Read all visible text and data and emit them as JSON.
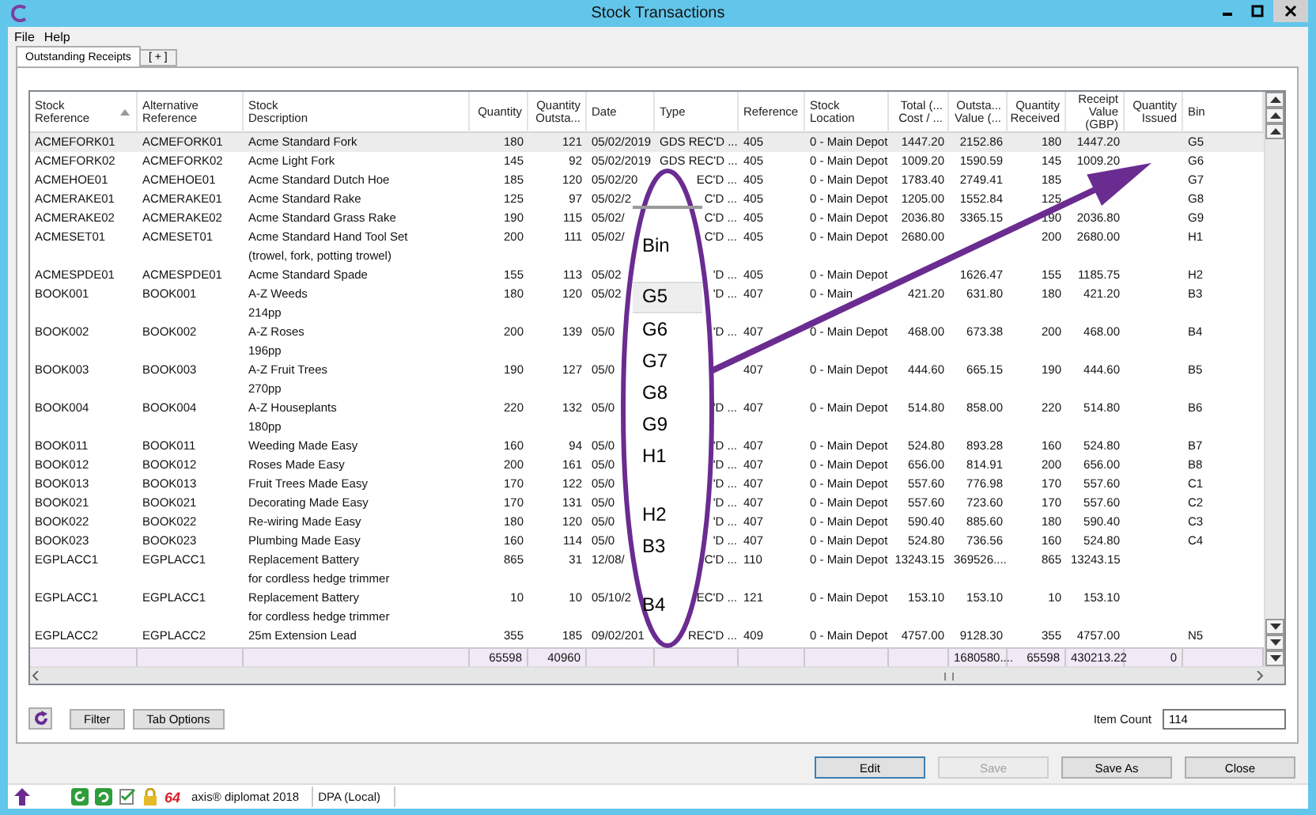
{
  "window": {
    "title": "Stock Transactions"
  },
  "menu": [
    "File",
    "Help"
  ],
  "tabs": [
    {
      "label": "Outstanding Receipts",
      "selected": true
    },
    {
      "label": "[ + ]",
      "selected": false
    }
  ],
  "table": {
    "columns": [
      {
        "label": [
          "Stock",
          "Reference"
        ],
        "sorted": true
      },
      {
        "label": [
          "Alternative",
          "Reference"
        ],
        "sorted": false
      },
      {
        "label": [
          "Stock",
          "Description"
        ],
        "sorted": false
      },
      {
        "label": [
          "Quantity"
        ],
        "sorted": false
      },
      {
        "label": [
          "Quantity",
          "Outsta..."
        ],
        "sorted": false
      },
      {
        "label": [
          "Date"
        ],
        "sorted": false
      },
      {
        "label": [
          "Type"
        ],
        "sorted": false
      },
      {
        "label": [
          "Reference"
        ],
        "sorted": false
      },
      {
        "label": [
          "Stock",
          "Location"
        ],
        "sorted": false
      },
      {
        "label": [
          "Total (...",
          "Cost / ..."
        ],
        "sorted": false
      },
      {
        "label": [
          "Outsta...",
          "Value (..."
        ],
        "sorted": false
      },
      {
        "label": [
          "Quantity",
          "Received"
        ],
        "sorted": false
      },
      {
        "label": [
          "Receipt",
          "Value",
          "(GBP)"
        ],
        "sorted": false
      },
      {
        "label": [
          "Quantity",
          "Issued"
        ],
        "sorted": false
      },
      {
        "label": [
          "Bin"
        ],
        "sorted": false
      }
    ],
    "rows": [
      {
        "selected": true,
        "stock_ref": "ACMEFORK01",
        "alt_ref": "ACMEFORK01",
        "description": [
          "Acme Standard Fork"
        ],
        "quantity": "180",
        "qty_outstanding": "121",
        "date": "05/02/2019",
        "type": "GDS REC'D ...",
        "reference": "405",
        "location": "0 - Main Depot",
        "total_cost": "1447.20",
        "outstanding_value": "2152.86",
        "qty_received": "180",
        "receipt_value": "1447.20",
        "bin": "G5"
      },
      {
        "selected": false,
        "stock_ref": "ACMEFORK02",
        "alt_ref": "ACMEFORK02",
        "description": [
          "Acme Light Fork"
        ],
        "quantity": "145",
        "qty_outstanding": "92",
        "date": "05/02/2019",
        "type": "GDS REC'D ...",
        "reference": "405",
        "location": "0 - Main Depot",
        "total_cost": "1009.20",
        "outstanding_value": "1590.59",
        "qty_received": "145",
        "receipt_value": "1009.20",
        "bin": "G6"
      },
      {
        "selected": false,
        "stock_ref": "ACMEHOE01",
        "alt_ref": "ACMEHOE01",
        "description": [
          "Acme Standard Dutch Hoe"
        ],
        "quantity": "185",
        "qty_outstanding": "120",
        "date": "05/02/20",
        "type": "EC'D ...",
        "reference": "405",
        "location": "0 - Main Depot",
        "total_cost": "1783.40",
        "outstanding_value": "2749.41",
        "qty_received": "185",
        "bin": "G7"
      },
      {
        "selected": false,
        "stock_ref": "ACMERAKE01",
        "alt_ref": "ACMERAKE01",
        "description": [
          "Acme Standard Rake"
        ],
        "quantity": "125",
        "qty_outstanding": "97",
        "date": "05/02/2",
        "type": "C'D ...",
        "reference": "405",
        "location": "0 - Main Depot",
        "total_cost": "1205.00",
        "outstanding_value": "1552.84",
        "qty_received": "125",
        "bin": "G8"
      },
      {
        "selected": false,
        "stock_ref": "ACMERAKE02",
        "alt_ref": "ACMERAKE02",
        "description": [
          "Acme Standard Grass Rake"
        ],
        "quantity": "190",
        "qty_outstanding": "115",
        "date": "05/02/",
        "type": "C'D ...",
        "reference": "405",
        "location": "0 - Main Depot",
        "total_cost": "2036.80",
        "outstanding_value": "3365.15",
        "qty_received": "190",
        "receipt_value": "2036.80",
        "bin": "G9"
      },
      {
        "selected": false,
        "stock_ref": "ACMESET01",
        "alt_ref": "ACMESET01",
        "description": [
          "Acme Standard Hand Tool Set",
          "(trowel, fork, potting trowel)"
        ],
        "quantity": "200",
        "qty_outstanding": "111",
        "date": "05/02/",
        "type": "C'D ...",
        "reference": "405",
        "location": "0 - Main Depot",
        "total_cost": "2680.00",
        "qty_received": "200",
        "receipt_value": "2680.00",
        "bin": "H1"
      },
      {
        "selected": false,
        "stock_ref": "ACMESPDE01",
        "alt_ref": "ACMESPDE01",
        "description": [
          "Acme Standard Spade"
        ],
        "quantity": "155",
        "qty_outstanding": "113",
        "date": "05/02",
        "type": "'D ...",
        "reference": "405",
        "location": "0 - Main Depot",
        "outstanding_value": "1626.47",
        "qty_received": "155",
        "receipt_value": "1185.75",
        "bin": "H2"
      },
      {
        "selected": false,
        "stock_ref": "BOOK001",
        "alt_ref": "BOOK001",
        "description": [
          "A-Z Weeds",
          "214pp"
        ],
        "quantity": "180",
        "qty_outstanding": "120",
        "date": "05/02",
        "type": "'D ...",
        "reference": "407",
        "location": "0 - Main",
        "total_cost": "421.20",
        "outstanding_value": "631.80",
        "qty_received": "180",
        "receipt_value": "421.20",
        "bin": "B3"
      },
      {
        "selected": false,
        "stock_ref": "BOOK002",
        "alt_ref": "BOOK002",
        "description": [
          "A-Z Roses",
          "196pp"
        ],
        "quantity": "200",
        "qty_outstanding": "139",
        "date": "05/0",
        "type": "'D ...",
        "reference": "407",
        "location": "0 - Main Depot",
        "total_cost": "468.00",
        "outstanding_value": "673.38",
        "qty_received": "200",
        "receipt_value": "468.00",
        "bin": "B4"
      },
      {
        "selected": false,
        "stock_ref": "BOOK003",
        "alt_ref": "BOOK003",
        "description": [
          "A-Z Fruit Trees",
          "270pp"
        ],
        "quantity": "190",
        "qty_outstanding": "127",
        "date": "05/0",
        "reference": "407",
        "location": "0 - Main Depot",
        "total_cost": "444.60",
        "outstanding_value": "665.15",
        "qty_received": "190",
        "receipt_value": "444.60",
        "bin": "B5"
      },
      {
        "selected": false,
        "stock_ref": "BOOK004",
        "alt_ref": "BOOK004",
        "description": [
          "A-Z Houseplants",
          "180pp"
        ],
        "quantity": "220",
        "qty_outstanding": "132",
        "date": "05/0",
        "type": "'D ...",
        "reference": "407",
        "location": "0 - Main Depot",
        "total_cost": "514.80",
        "outstanding_value": "858.00",
        "qty_received": "220",
        "receipt_value": "514.80",
        "bin": "B6"
      },
      {
        "selected": false,
        "stock_ref": "BOOK011",
        "alt_ref": "BOOK011",
        "description": [
          "Weeding Made Easy"
        ],
        "quantity": "160",
        "qty_outstanding": "94",
        "date": "05/0",
        "type": "'D ...",
        "reference": "407",
        "location": "0 - Main Depot",
        "total_cost": "524.80",
        "outstanding_value": "893.28",
        "qty_received": "160",
        "receipt_value": "524.80",
        "bin": "B7"
      },
      {
        "selected": false,
        "stock_ref": "BOOK012",
        "alt_ref": "BOOK012",
        "description": [
          "Roses Made Easy"
        ],
        "quantity": "200",
        "qty_outstanding": "161",
        "date": "05/0",
        "type": "'D ...",
        "reference": "407",
        "location": "0 - Main Depot",
        "total_cost": "656.00",
        "outstanding_value": "814.91",
        "qty_received": "200",
        "receipt_value": "656.00",
        "bin": "B8"
      },
      {
        "selected": false,
        "stock_ref": "BOOK013",
        "alt_ref": "BOOK013",
        "description": [
          "Fruit Trees Made Easy"
        ],
        "quantity": "170",
        "qty_outstanding": "122",
        "date": "05/0",
        "type": "'D ...",
        "reference": "407",
        "location": "0 - Main Depot",
        "total_cost": "557.60",
        "outstanding_value": "776.98",
        "qty_received": "170",
        "receipt_value": "557.60",
        "bin": "C1"
      },
      {
        "selected": false,
        "stock_ref": "BOOK021",
        "alt_ref": "BOOK021",
        "description": [
          "Decorating Made Easy"
        ],
        "quantity": "170",
        "qty_outstanding": "131",
        "date": "05/0",
        "type": "'D ...",
        "reference": "407",
        "location": "0 - Main Depot",
        "total_cost": "557.60",
        "outstanding_value": "723.60",
        "qty_received": "170",
        "receipt_value": "557.60",
        "bin": "C2"
      },
      {
        "selected": false,
        "stock_ref": "BOOK022",
        "alt_ref": "BOOK022",
        "description": [
          "Re-wiring Made Easy"
        ],
        "quantity": "180",
        "qty_outstanding": "120",
        "date": "05/0",
        "type": "'D ...",
        "reference": "407",
        "location": "0 - Main Depot",
        "total_cost": "590.40",
        "outstanding_value": "885.60",
        "qty_received": "180",
        "receipt_value": "590.40",
        "bin": "C3"
      },
      {
        "selected": false,
        "stock_ref": "BOOK023",
        "alt_ref": "BOOK023",
        "description": [
          "Plumbing Made Easy"
        ],
        "quantity": "160",
        "qty_outstanding": "114",
        "date": "05/0",
        "type": "'D ...",
        "reference": "407",
        "location": "0 - Main Depot",
        "total_cost": "524.80",
        "outstanding_value": "736.56",
        "qty_received": "160",
        "receipt_value": "524.80",
        "bin": "C4"
      },
      {
        "selected": false,
        "stock_ref": "EGPLACC1",
        "alt_ref": "EGPLACC1",
        "description": [
          "Replacement Battery",
          "for cordless hedge trimmer"
        ],
        "quantity": "865",
        "qty_outstanding": "31",
        "date": "12/08/",
        "type": "C'D ...",
        "reference": "110",
        "location": "0 - Main Depot",
        "total_cost": "13243.15",
        "outstanding_value": "369526....",
        "qty_received": "865",
        "receipt_value": "13243.15"
      },
      {
        "selected": false,
        "stock_ref": "EGPLACC1",
        "alt_ref": "EGPLACC1",
        "description": [
          "Replacement Battery",
          "for cordless hedge trimmer"
        ],
        "quantity": "10",
        "qty_outstanding": "10",
        "date": "05/10/2",
        "type": "EC'D ...",
        "reference": "121",
        "location": "0 - Main Depot",
        "total_cost": "153.10",
        "outstanding_value": "153.10",
        "qty_received": "10",
        "receipt_value": "153.10"
      },
      {
        "selected": false,
        "stock_ref": "EGPLACC2",
        "alt_ref": "EGPLACC2",
        "description": [
          "25m Extension Lead"
        ],
        "quantity": "355",
        "qty_outstanding": "185",
        "date": "09/02/201",
        "type": "REC'D ...",
        "reference": "409",
        "location": "0 - Main Depot",
        "total_cost": "4757.00",
        "outstanding_value": "9128.30",
        "qty_received": "355",
        "receipt_value": "4757.00",
        "bin": "N5"
      }
    ],
    "totals": {
      "quantity": "65598",
      "qty_outstanding": "40960",
      "outstanding_value": "1680580....",
      "qty_received": "65598",
      "receipt_value": "430213.22",
      "qty_issued": "0"
    }
  },
  "callout": {
    "header": "Bin",
    "entries": [
      {
        "text": "G5",
        "selected": true,
        "spaced": false
      },
      {
        "text": "G6",
        "selected": false,
        "spaced": false
      },
      {
        "text": "G7",
        "selected": false,
        "spaced": false
      },
      {
        "text": "G8",
        "selected": false,
        "spaced": false
      },
      {
        "text": "G9",
        "selected": false,
        "spaced": false
      },
      {
        "text": "H1",
        "selected": false,
        "spaced": false
      },
      {
        "text": "H2",
        "selected": false,
        "spaced": true
      },
      {
        "text": "B3",
        "selected": false,
        "spaced": false
      },
      {
        "text": "B4",
        "selected": false,
        "spaced": true
      }
    ]
  },
  "tools": {
    "buttons": [
      "Filter",
      "Tab Options"
    ],
    "item_count_label": "Item Count",
    "item_count": "114"
  },
  "actions": [
    {
      "label": "Edit",
      "disabled": false,
      "default": true
    },
    {
      "label": "Save",
      "disabled": true,
      "default": false
    },
    {
      "label": "Save As",
      "disabled": false,
      "default": false
    },
    {
      "label": "Close",
      "disabled": false,
      "default": false
    }
  ],
  "status_bar": {
    "logo": "64",
    "product": "axis® diplomat 2018",
    "database": "DPA (Local)"
  }
}
